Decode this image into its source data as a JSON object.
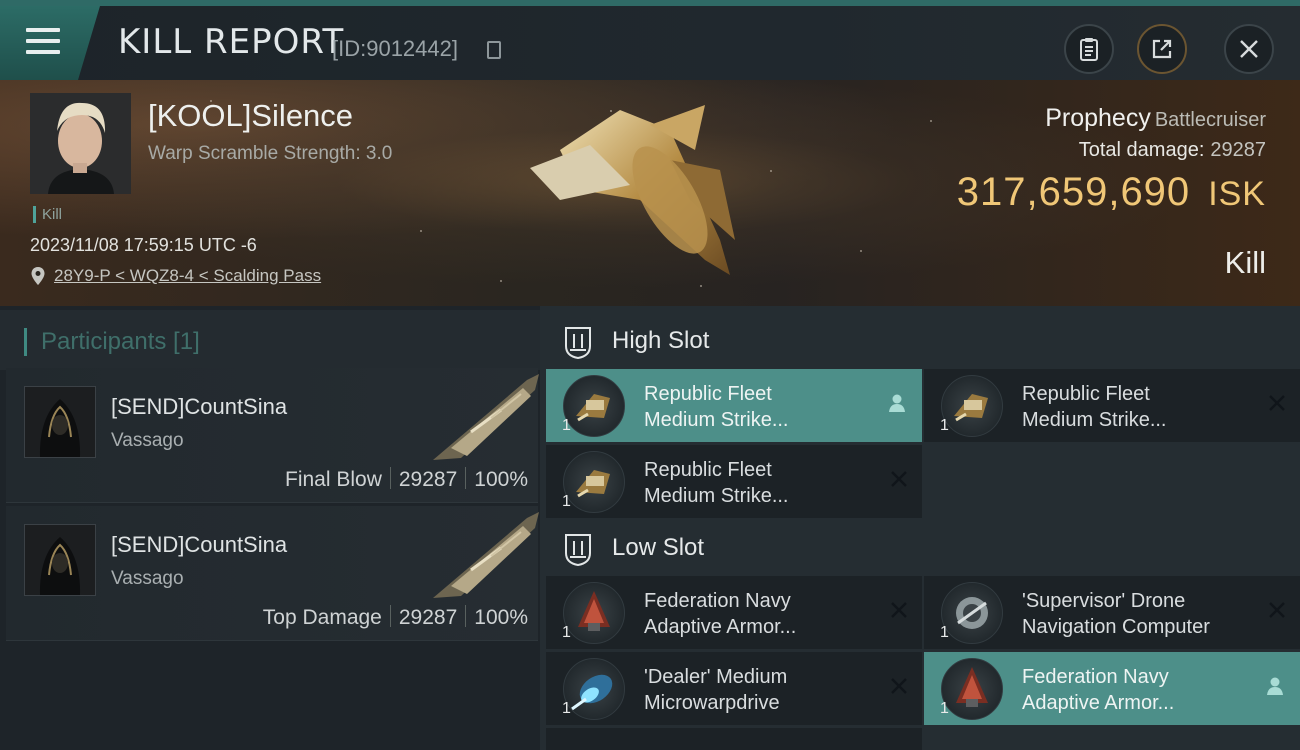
{
  "header": {
    "title": "KILL REPORT",
    "report_id": "[ID:9012442]"
  },
  "victim": {
    "name": "[KOOL]Silence",
    "warp_scramble": "Warp Scramble Strength: 3.0",
    "tag": "Kill",
    "datetime": "2023/11/08 17:59:15 UTC -6",
    "location": "28Y9-P < WQZ8-4 < Scalding Pass",
    "ship_name": "Prophecy",
    "ship_class": "Battlecruiser",
    "total_damage_label": "Total damage:",
    "total_damage": "29287",
    "isk_value": "317,659,690",
    "isk_unit": "ISK",
    "result": "Kill"
  },
  "participants": {
    "title": "Participants [1]",
    "rows": [
      {
        "name": "[SEND]CountSina",
        "ship": "Vassago",
        "role": "Final Blow",
        "damage": "29287",
        "percent": "100%"
      },
      {
        "name": "[SEND]CountSina",
        "ship": "Vassago",
        "role": "Top Damage",
        "damage": "29287",
        "percent": "100%"
      }
    ]
  },
  "fitting": {
    "high_slot_label": "High Slot",
    "low_slot_label": "Low Slot",
    "high": [
      {
        "line1": "Republic Fleet",
        "line2": "Medium Strike...",
        "qty": "1",
        "state": "dropped"
      },
      {
        "line1": "Republic Fleet",
        "line2": "Medium Strike...",
        "qty": "1",
        "state": "destroyed"
      },
      {
        "line1": "Republic Fleet",
        "line2": "Medium Strike...",
        "qty": "1",
        "state": "destroyed"
      }
    ],
    "low": [
      {
        "line1": "Federation Navy",
        "line2": "Adaptive Armor...",
        "qty": "1",
        "state": "destroyed"
      },
      {
        "line1": "'Supervisor' Drone",
        "line2": "Navigation Computer",
        "qty": "1",
        "state": "destroyed"
      },
      {
        "line1": "'Dealer' Medium",
        "line2": "Microwarpdrive",
        "qty": "1",
        "state": "destroyed"
      },
      {
        "line1": "Federation Navy",
        "line2": "Adaptive Armor...",
        "qty": "1",
        "state": "dropped"
      }
    ]
  },
  "icons": {
    "menu": "menu-icon",
    "copy": "copy-icon",
    "clipboard": "clipboard-icon",
    "share": "share-icon",
    "close": "close-icon",
    "location": "location-pin-icon",
    "slot": "slot-icon",
    "destroyed": "x-icon",
    "dropped": "person-icon"
  },
  "colors": {
    "accent": "#4d8f89",
    "isk": "#f0c777",
    "panel": "#252d32"
  }
}
